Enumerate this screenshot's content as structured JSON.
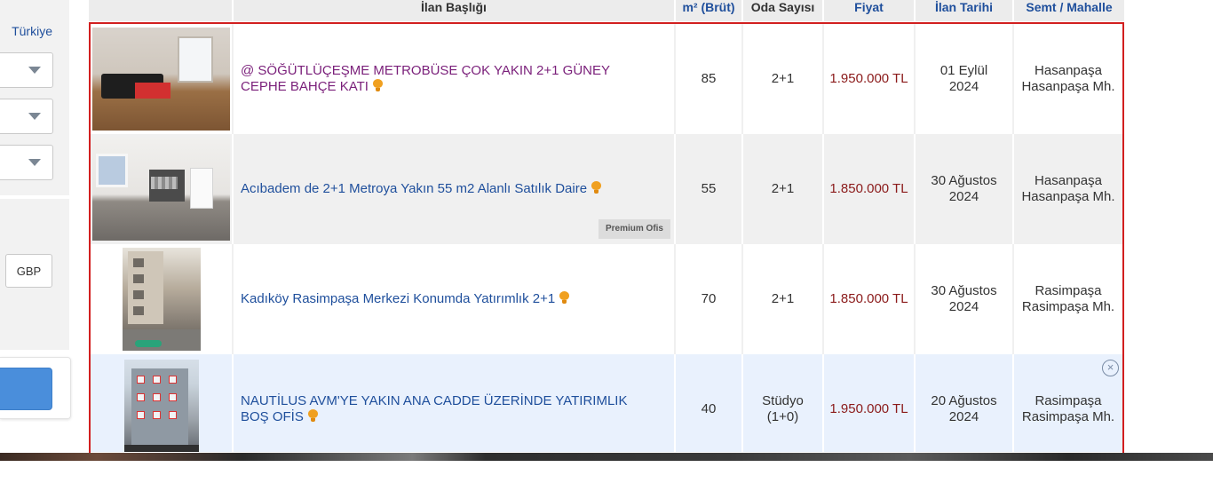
{
  "sidebar": {
    "country_link": "Türkiye",
    "currency_label": "GBP"
  },
  "table": {
    "headers": {
      "image": "",
      "title": "İlan Başlığı",
      "m2": "m² (Brüt)",
      "rooms": "Oda Sayısı",
      "price": "Fiyat",
      "date": "İlan Tarihi",
      "location": "Semt / Mahalle"
    },
    "rows": [
      {
        "title": "@ SÖĞÜTLÜÇEŞME METROBÜSE ÇOK YAKIN 2+1 GÜNEY CEPHE BAHÇE KATI",
        "m2": "85",
        "rooms": "2+1",
        "price": "1.950.000 TL",
        "date_line1": "01 Eylül",
        "date_line2": "2024",
        "loc_line1": "Hasanpaşa",
        "loc_line2": "Hasanpaşa Mh.",
        "badge": ""
      },
      {
        "title": "Acıbadem de 2+1 Metroya Yakın 55 m2 Alanlı Satılık Daire",
        "m2": "55",
        "rooms": "2+1",
        "price": "1.850.000 TL",
        "date_line1": "30 Ağustos",
        "date_line2": "2024",
        "loc_line1": "Hasanpaşa",
        "loc_line2": "Hasanpaşa Mh.",
        "badge": "Premium Ofis"
      },
      {
        "title": "Kadıköy Rasimpaşa Merkezi Konumda Yatırımlık 2+1",
        "m2": "70",
        "rooms": "2+1",
        "price": "1.850.000 TL",
        "date_line1": "30 Ağustos",
        "date_line2": "2024",
        "loc_line1": "Rasimpaşa",
        "loc_line2": "Rasimpaşa Mh.",
        "badge": ""
      },
      {
        "title": "NAUTİLUS AVM'YE YAKIN ANA CADDE ÜZERİNDE YATIRIMLIK BOŞ OFİS",
        "m2": "40",
        "rooms_line1": "Stüdyo",
        "rooms_line2": "(1+0)",
        "price": "1.950.000 TL",
        "date_line1": "20 Ağustos",
        "date_line2": "2024",
        "loc_line1": "Rasimpaşa",
        "loc_line2": "Rasimpaşa Mh.",
        "badge": ""
      }
    ]
  },
  "colors": {
    "accent": "#1f4f9c",
    "price": "#8b1a1a",
    "visited_link": "#7a1f7a",
    "outline": "#d21f1f",
    "search_button": "#4a8edb"
  },
  "icons": {
    "select_caret": "chevron-down-icon",
    "title_marker": "lightbulb-icon",
    "row_close": "close-circle-icon"
  }
}
